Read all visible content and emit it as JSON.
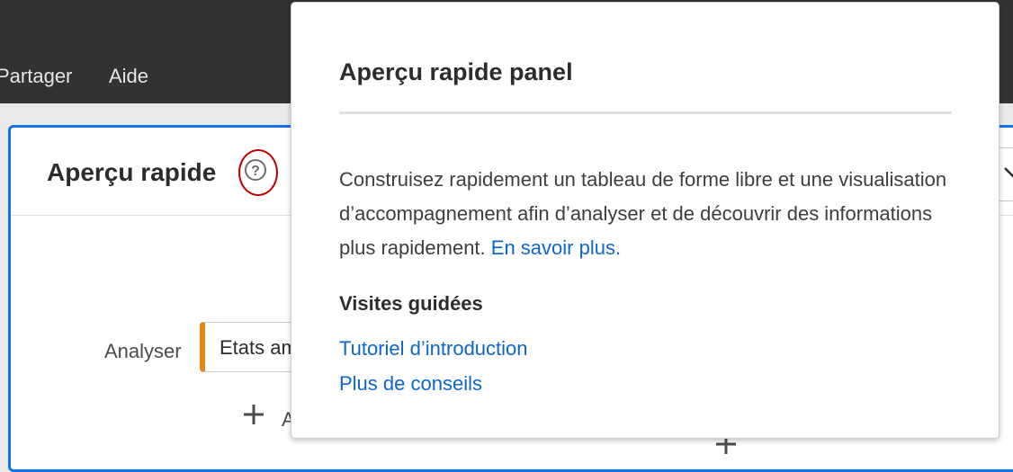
{
  "menubar": {
    "items": [
      "Partager",
      "Aide"
    ]
  },
  "panel": {
    "title": "Aperçu rapide",
    "help_glyph": "?",
    "analyser_label": "Analyser",
    "analyser_value": "Etats am",
    "add_label": "A"
  },
  "popover": {
    "title": "Aperçu rapide panel",
    "body": "Construisez rapidement un tableau de forme libre et une visualisation d’accompagnement afin d’analyser et de découvrir des informations plus rapidement.",
    "learn_more": "En savoir plus.",
    "section_title": "Visites guidées",
    "links": [
      "Tutoriel d’introduction",
      "Plus de conseils"
    ]
  },
  "colors": {
    "accent": "#1473e6",
    "link": "#0d66d0",
    "highlight_ring": "#c00000",
    "analyser_marker": "#e68619"
  }
}
